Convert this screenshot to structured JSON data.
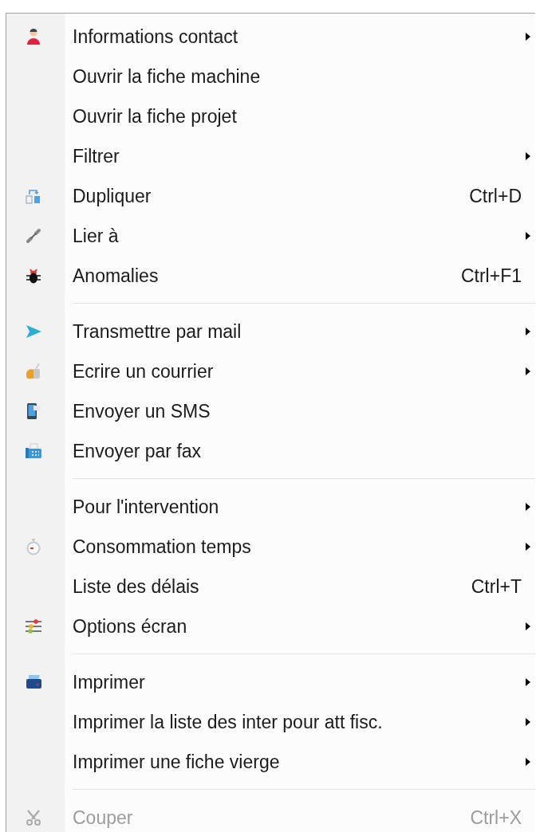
{
  "menu": {
    "groups": [
      [
        {
          "label": "Informations contact",
          "submenu": true,
          "disabled": false
        },
        {
          "label": "Ouvrir la fiche machine",
          "submenu": false,
          "disabled": false
        },
        {
          "label": "Ouvrir la fiche projet",
          "submenu": false,
          "disabled": false
        },
        {
          "label": "Filtrer",
          "submenu": true,
          "disabled": false
        },
        {
          "label": "Dupliquer",
          "shortcut": "Ctrl+D",
          "submenu": false,
          "disabled": false
        },
        {
          "label": "Lier à",
          "submenu": true,
          "disabled": false
        },
        {
          "label": "Anomalies",
          "shortcut": "Ctrl+F1",
          "submenu": false,
          "disabled": false
        }
      ],
      [
        {
          "label": "Transmettre par mail",
          "submenu": true,
          "disabled": false
        },
        {
          "label": "Ecrire un courrier",
          "submenu": true,
          "disabled": false
        },
        {
          "label": "Envoyer un SMS",
          "submenu": false,
          "disabled": false
        },
        {
          "label": "Envoyer par fax",
          "submenu": false,
          "disabled": false
        }
      ],
      [
        {
          "label": "Pour l'intervention",
          "submenu": true,
          "disabled": false
        },
        {
          "label": "Consommation temps",
          "submenu": true,
          "disabled": false
        },
        {
          "label": "Liste des délais",
          "shortcut": "Ctrl+T",
          "submenu": false,
          "disabled": false
        },
        {
          "label": "Options écran",
          "submenu": true,
          "disabled": false
        }
      ],
      [
        {
          "label": "Imprimer",
          "submenu": true,
          "disabled": false
        },
        {
          "label": "Imprimer la liste des inter pour att fisc.",
          "submenu": true,
          "disabled": false
        },
        {
          "label": "Imprimer une fiche vierge",
          "submenu": true,
          "disabled": false
        }
      ],
      [
        {
          "label": "Couper",
          "shortcut": "Ctrl+X",
          "submenu": false,
          "disabled": true
        }
      ]
    ]
  }
}
